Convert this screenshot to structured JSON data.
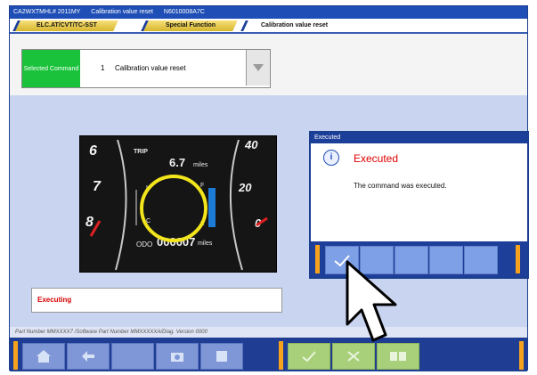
{
  "window": {
    "title_parts": [
      "CA2WXTMHL# 2011MY",
      "Calibration value reset",
      "N6010008A7C"
    ]
  },
  "tabs": [
    {
      "label": "ELC.AT/CVT/TC-SST"
    },
    {
      "label": "Special Function"
    },
    {
      "label": "Calibration value reset"
    }
  ],
  "command": {
    "label": "Selected Command",
    "number": "1",
    "name": "Calibration value reset",
    "dropdown_icon": "chevron-down-icon"
  },
  "cluster": {
    "left_digits": [
      "6",
      "7",
      "8"
    ],
    "right_digits": [
      "40",
      "20",
      "0"
    ],
    "trip_label": "TRIP",
    "trip_value": "6.7",
    "trip_unit": "miles",
    "odo_label": "ODO",
    "odo_value": "000007",
    "odo_unit": "miles",
    "fuel_labels": [
      "F",
      "E"
    ],
    "temp_labels": [
      "H",
      "C"
    ],
    "highlight_color": "#f2e51c"
  },
  "status": {
    "text": "Executing"
  },
  "footer": {
    "part_number": "Part Number MMXXXX7 /Software Part Number MMXXXXXA/Diag. Version 0000"
  },
  "dialog": {
    "title": "Executed",
    "heading": "Executed",
    "message": "The command was executed.",
    "ok_icon": "checkmark-icon"
  },
  "toolbar": {
    "left_icons": [
      "home-icon",
      "back-icon",
      "blank",
      "camera-icon",
      "help-icon"
    ],
    "right_icons": [
      "checkmark-icon",
      "cross-icon",
      "print-icon"
    ]
  }
}
